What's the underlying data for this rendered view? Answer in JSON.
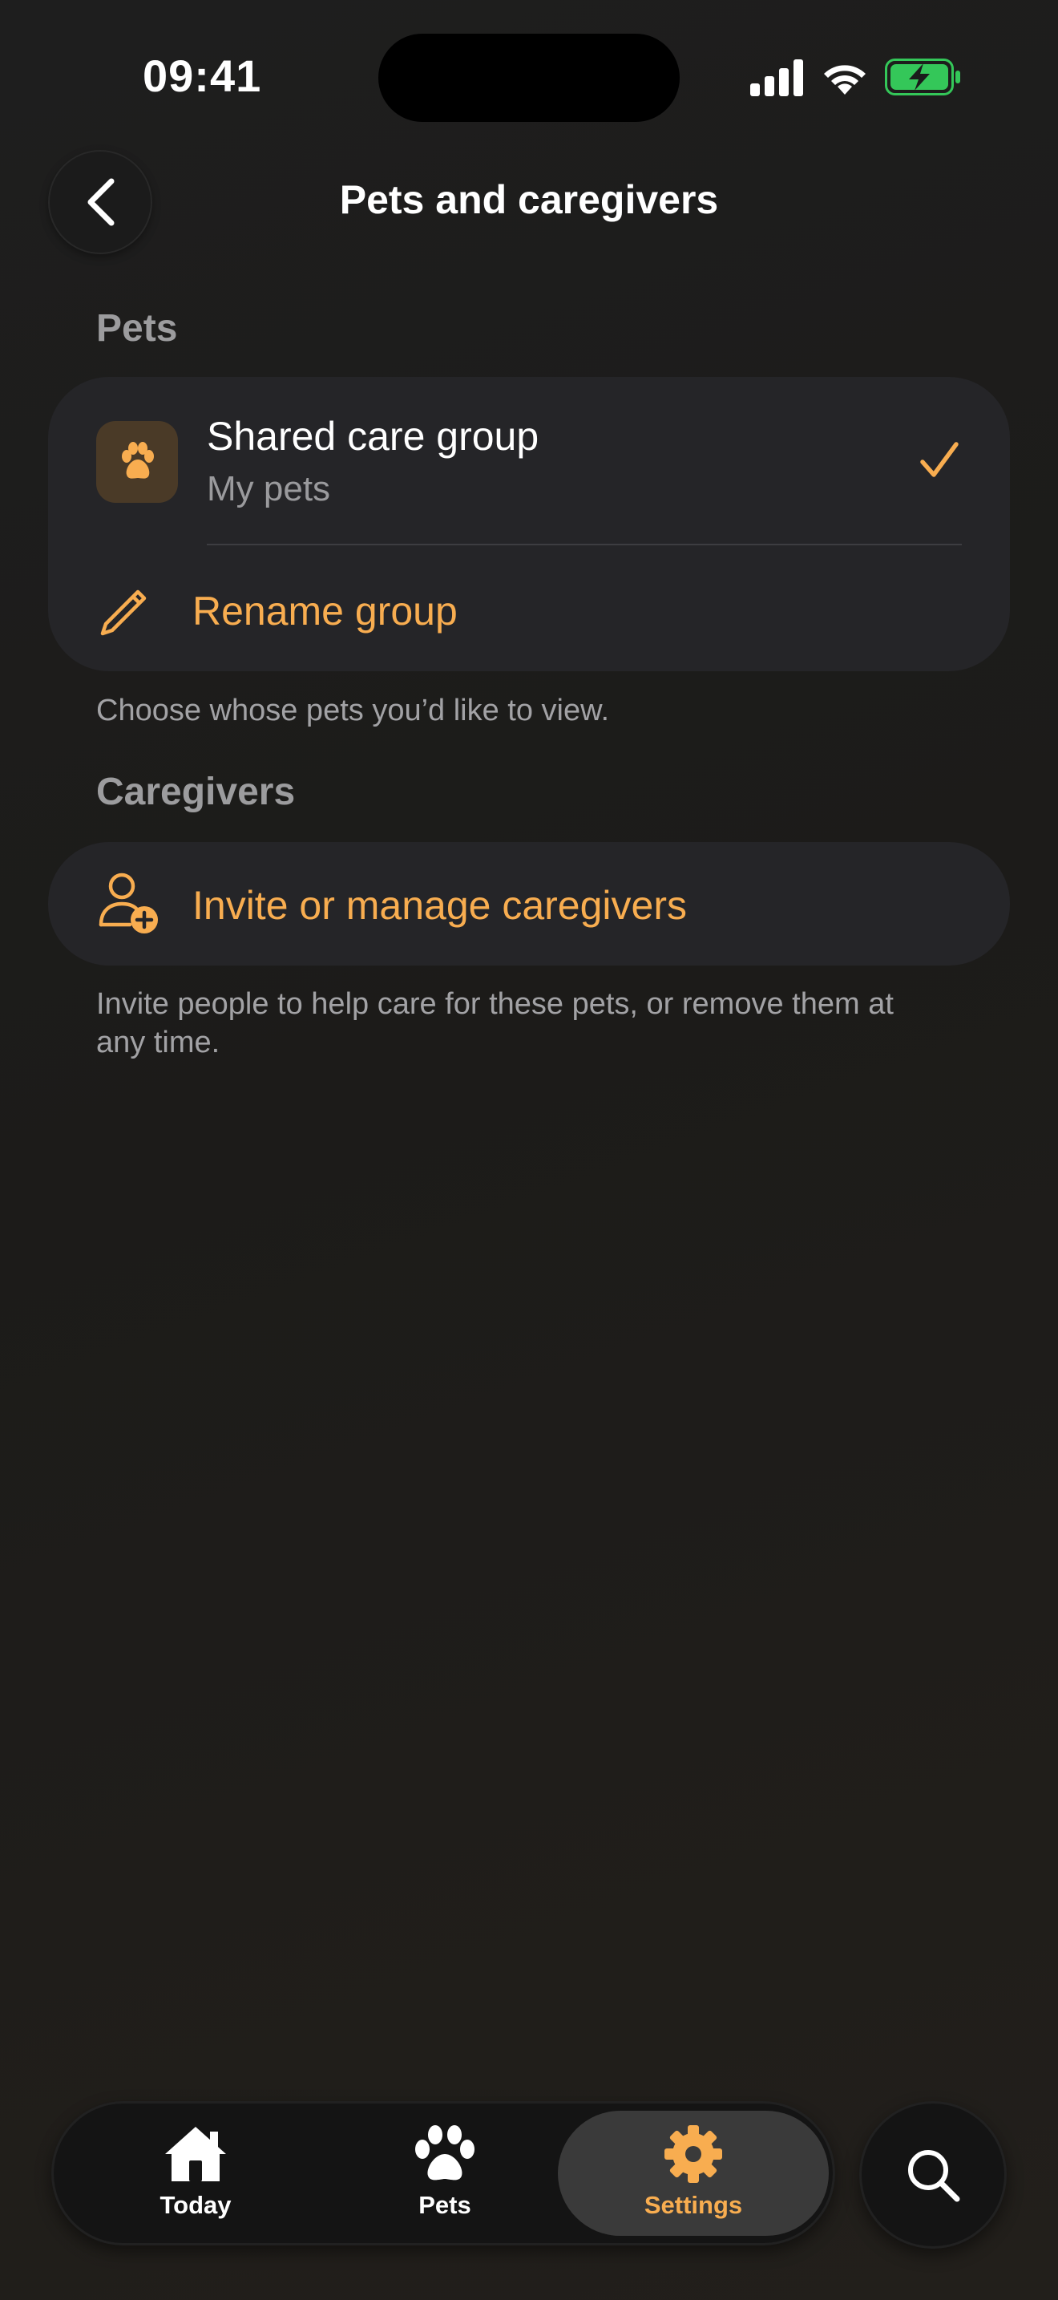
{
  "status_bar": {
    "time": "09:41"
  },
  "nav": {
    "title": "Pets and caregivers",
    "back_icon": "chevron-left-icon"
  },
  "pets_section": {
    "header": "Pets",
    "group": {
      "title": "Shared care group",
      "subtitle": "My pets",
      "selected": true,
      "icon": "paw-icon"
    },
    "rename_label": "Rename group",
    "footnote": "Choose whose pets you’d like to view."
  },
  "caregivers_section": {
    "header": "Caregivers",
    "invite_label": "Invite or manage caregivers",
    "footnote_line1": "Invite people to help care for these pets, or remove them at",
    "footnote_line2": "any time."
  },
  "tab_bar": {
    "tabs": [
      {
        "label": "Today",
        "icon": "house-icon",
        "active": false
      },
      {
        "label": "Pets",
        "icon": "paw-icon",
        "active": false
      },
      {
        "label": "Settings",
        "icon": "gear-icon",
        "active": true
      }
    ],
    "search_icon": "search-icon"
  },
  "colors": {
    "accent": "#F8AD50",
    "card": "#252528",
    "battery": "#34C759"
  }
}
